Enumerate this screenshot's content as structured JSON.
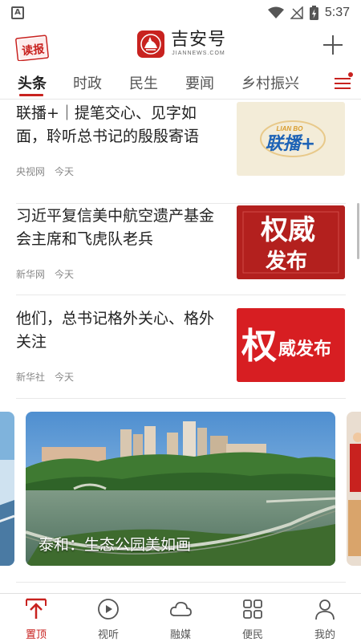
{
  "status_bar": {
    "time": "5:37",
    "app_icon_letter": "A"
  },
  "header": {
    "read_logo_text": "读报",
    "brand_name": "吉安号",
    "brand_sub": "JIANNEWS.COM",
    "brand_color": "#c8221f"
  },
  "tabs": [
    {
      "label": "头条",
      "active": true
    },
    {
      "label": "时政",
      "active": false
    },
    {
      "label": "民生",
      "active": false
    },
    {
      "label": "要闻",
      "active": false
    },
    {
      "label": "乡村振兴",
      "active": false
    }
  ],
  "news": [
    {
      "title": "联播+｜提笔交心、见字如面，聆听总书记的殷殷寄语",
      "source": "央视网",
      "time": "今天",
      "thumb_text": "联播+",
      "thumb_sub": "LIAN BO"
    },
    {
      "title": "习近平复信美中航空遗产基金会主席和飞虎队老兵",
      "source": "新华网",
      "time": "今天",
      "thumb_text_1": "权威",
      "thumb_text_2": "发布"
    },
    {
      "title": "他们，总书记格外关心、格外关注",
      "source": "新华社",
      "time": "今天",
      "thumb_text_1": "权",
      "thumb_text_2": "威发布"
    }
  ],
  "carousel": {
    "caption": "泰和：生态公园美如画"
  },
  "bottom_nav": [
    {
      "label": "置顶",
      "icon": "pin-top-icon",
      "active": true
    },
    {
      "label": "视听",
      "icon": "play-icon",
      "active": false
    },
    {
      "label": "融媒",
      "icon": "cloud-icon",
      "active": false
    },
    {
      "label": "便民",
      "icon": "grid-icon",
      "active": false
    },
    {
      "label": "我的",
      "icon": "user-icon",
      "active": false
    }
  ]
}
